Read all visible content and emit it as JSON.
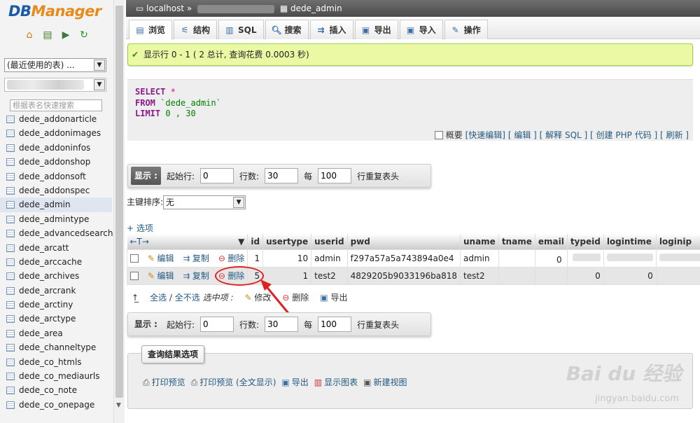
{
  "sidebar": {
    "logo_db": "DB",
    "logo_manager": "Manager",
    "recent_select": "(最近使用的表) ...",
    "search_placeholder": "根据表名快速搜索",
    "tables": [
      "dede_addonarticle",
      "dede_addonimages",
      "dede_addoninfos",
      "dede_addonshop",
      "dede_addonsoft",
      "dede_addonspec",
      "dede_admin",
      "dede_admintype",
      "dede_advancedsearch",
      "dede_arcatt",
      "dede_arccache",
      "dede_archives",
      "dede_arcrank",
      "dede_arctiny",
      "dede_arctype",
      "dede_area",
      "dede_channeltype",
      "dede_co_htmls",
      "dede_co_mediaurls",
      "dede_co_note",
      "dede_co_onepage"
    ],
    "active_table": "dede_admin"
  },
  "breadcrumb": {
    "server": "localhost",
    "sep": "»",
    "table": "dede_admin"
  },
  "tabs": [
    {
      "label": "浏览",
      "icon": "browse-icon"
    },
    {
      "label": "结构",
      "icon": "structure-icon"
    },
    {
      "label": "SQL",
      "icon": "sql-icon"
    },
    {
      "label": "搜索",
      "icon": "search-icon"
    },
    {
      "label": "插入",
      "icon": "insert-icon"
    },
    {
      "label": "导出",
      "icon": "export-icon"
    },
    {
      "label": "导入",
      "icon": "import-icon"
    },
    {
      "label": "操作",
      "icon": "wrench-icon"
    }
  ],
  "notice": "显示行 0 - 1 ( 2 总计, 查询花费 0.0003 秒)",
  "sql": {
    "kw_select": "SELECT",
    "star": "*",
    "kw_from": "FROM",
    "table": "`dede_admin`",
    "kw_limit": "LIMIT",
    "limit_args": "0 , 30"
  },
  "sql_links": {
    "profile": "概要",
    "inline_edit": "[快速编辑]",
    "edit": "[ 编辑 ]",
    "explain": "[ 解释 SQL ]",
    "php_code": "[ 创建 PHP 代码 ]",
    "refresh": "[ 刷新 ]"
  },
  "nav": {
    "show": "显示 :",
    "start_label": "起始行:",
    "start_value": "0",
    "rows_label": "行数:",
    "rows_value": "30",
    "per_label": "每",
    "repeat_value": "100",
    "repeat_label": "行重复表头"
  },
  "sort": {
    "label": "主键排序:",
    "value": "无"
  },
  "options_link": "+ 选项",
  "table": {
    "columns": [
      "id",
      "usertype",
      "userid",
      "pwd",
      "uname",
      "tname",
      "email",
      "typeid",
      "logintime",
      "loginip"
    ],
    "actions": {
      "edit": "编辑",
      "copy": "复制",
      "delete": "删除"
    },
    "rows": [
      {
        "id": "1",
        "usertype": "10",
        "userid": "admin",
        "pwd": "f297a57a5a743894a0e4",
        "uname": "admin",
        "typeid": "0",
        "logintime": "",
        "loginip": ""
      },
      {
        "id": "5",
        "usertype": "1",
        "userid": "test2",
        "pwd": "4829205b9033196ba818",
        "uname": "test2",
        "typeid": "0",
        "logintime": "0",
        "loginip": ""
      }
    ]
  },
  "bulk": {
    "check_all": "全选",
    "slash": "/",
    "uncheck_all": "全不选",
    "selected": "选中项 :",
    "edit": "修改",
    "delete": "删除",
    "export": "导出"
  },
  "query_ops": {
    "legend": "查询结果选项",
    "print": "打印预览",
    "print_full": "打印预览 (全文显示)",
    "export": "导出",
    "chart": "显示图表",
    "create_view": "新建视图"
  },
  "watermark": {
    "brand": "Bai du 经验",
    "url": "jingyan.baidu.com"
  },
  "colors": {
    "link": "#235a81",
    "notice_bg": "#ebf8a4",
    "keyword": "#8b1a8b",
    "annotation": "#dd2222"
  }
}
